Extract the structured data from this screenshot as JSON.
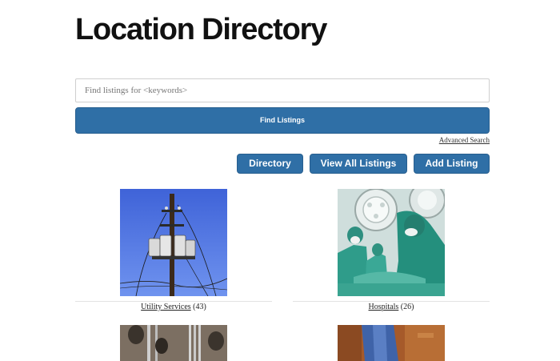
{
  "page": {
    "title": "Location Directory"
  },
  "search": {
    "placeholder": "Find listings for <keywords>",
    "button_label": "Find Listings",
    "advanced_label": "Advanced Search"
  },
  "nav": {
    "directory": "Directory",
    "view_all": "View All Listings",
    "add": "Add Listing"
  },
  "categories": [
    {
      "name": "Utility Services",
      "count": "(43)"
    },
    {
      "name": "Hospitals",
      "count": "(26)"
    }
  ],
  "colors": {
    "button": "#2f6fa6",
    "text": "#111111"
  }
}
